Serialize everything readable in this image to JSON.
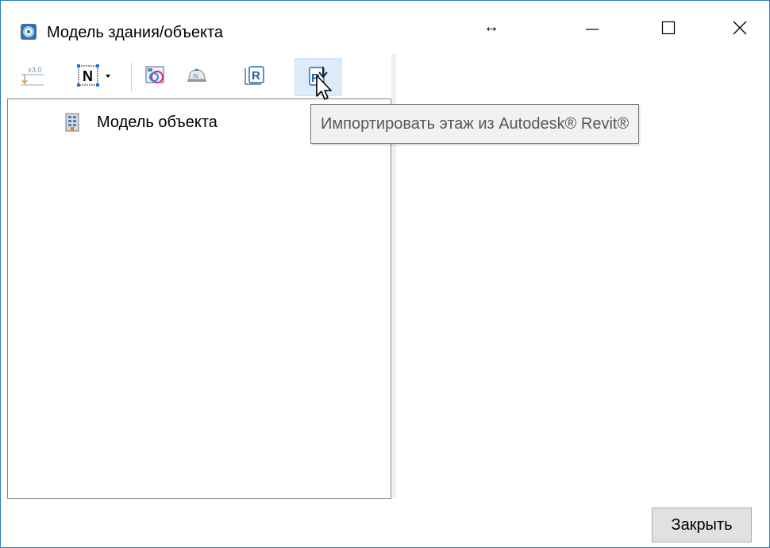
{
  "window": {
    "title": "Модель здания/объекта",
    "resize_icon": "↔",
    "controls": {
      "minimize_icon": "minimize-icon",
      "maximize_icon": "maximize-icon",
      "close_icon": "close-icon"
    }
  },
  "toolbar": {
    "buttons": [
      {
        "icon": "level-marker-icon",
        "caption": "±3.0"
      },
      {
        "icon": "numbering-icon",
        "caption": "N"
      },
      {
        "icon": "image-link-icon"
      },
      {
        "icon": "hard-hat-icon"
      },
      {
        "icon": "revit-export-icon",
        "caption": "R"
      },
      {
        "icon": "revit-import-icon",
        "caption": "R"
      }
    ]
  },
  "tree": {
    "items": [
      {
        "label": "Модель объекта",
        "icon": "building-icon"
      }
    ]
  },
  "tooltip": {
    "text": "Импортировать этаж из Autodesk® Revit®"
  },
  "footer": {
    "close_label": "Закрыть"
  },
  "colors": {
    "window_border": "#2b79c9",
    "accent": "#1e6fd9",
    "hover_bg": "#dcecfb",
    "tooltip_bg": "#f1f1f1",
    "button_bg": "#e1e1e1"
  }
}
